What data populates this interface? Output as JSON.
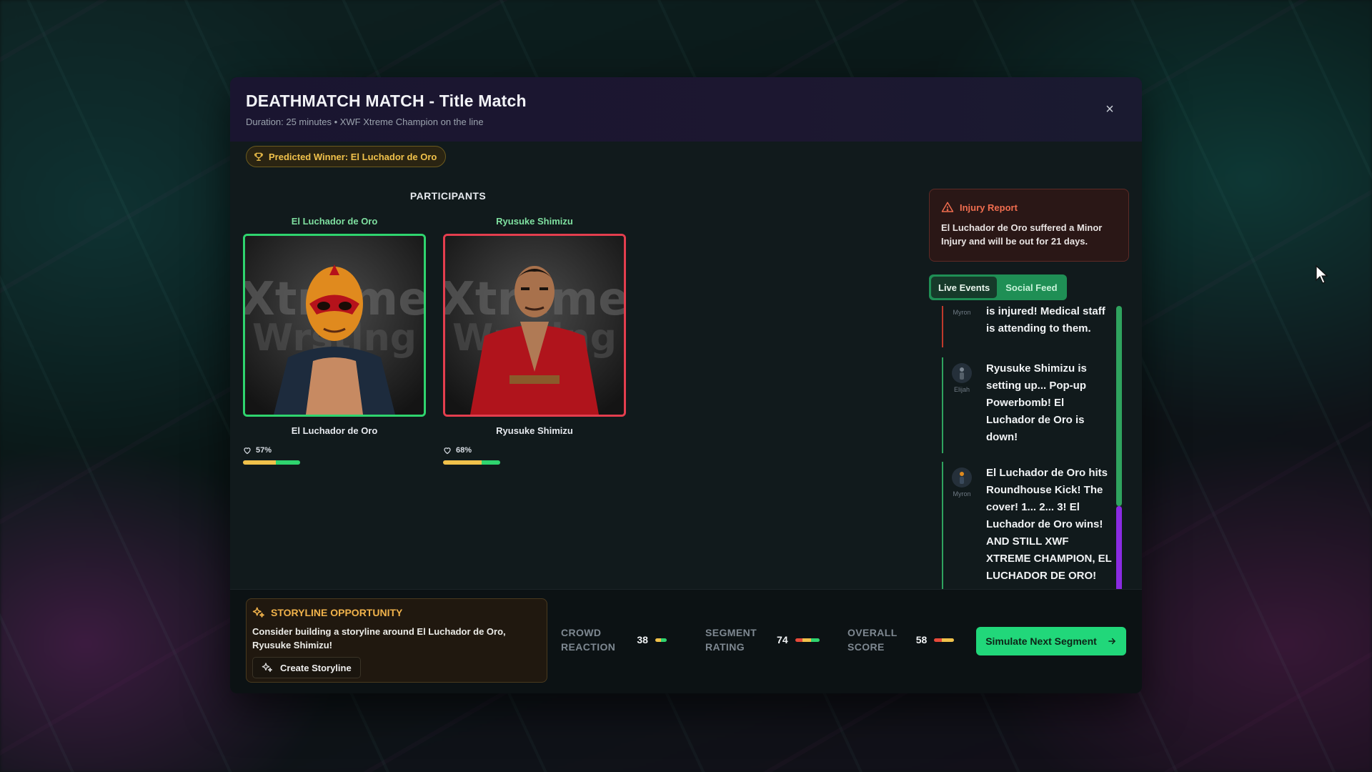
{
  "modal": {
    "title": "DEATHMATCH MATCH - Title Match",
    "subtitle": "Duration: 25 minutes • XWF Xtreme Champion on the line",
    "close_label": "×",
    "predicted_winner": "Predicted Winner: El Luchador de Oro"
  },
  "participants": {
    "title": "PARTICIPANTS",
    "items": [
      {
        "name": "El Luchador de Oro",
        "popularity": "57%",
        "popularity_value": 57,
        "status_color": "#2fd46e"
      },
      {
        "name": "Ryusuke Shimizu",
        "popularity": "68%",
        "popularity_value": 68,
        "status_color": "#e43e4e"
      }
    ]
  },
  "injury": {
    "title": "Injury Report",
    "text": "El Luchador de Oro suffered a Minor Injury and will be out for 21 days."
  },
  "tabs": [
    {
      "label": "Live Events",
      "active": true
    },
    {
      "label": "Social Feed",
      "active": false
    }
  ],
  "feed": [
    {
      "author": "Myron",
      "text": "is injured! Medical staff is attending to them.",
      "tone": "red"
    },
    {
      "author": "Elijah",
      "text": "Ryusuke Shimizu is setting up... Pop-up Powerbomb! El Luchador de Oro is down!",
      "tone": "green"
    },
    {
      "author": "Myron",
      "text": "El Luchador de Oro hits Roundhouse Kick! The cover! 1... 2... 3! El Luchador de Oro wins! AND STILL XWF XTREME CHAMPION, EL LUCHADOR DE ORO!",
      "tone": "green"
    }
  ],
  "storyline": {
    "title": "STORYLINE OPPORTUNITY",
    "text": "Consider building a storyline around El Luchador de Oro, Ryusuke Shimizu!",
    "button": "Create Storyline"
  },
  "metrics": [
    {
      "label_line1": "CROWD",
      "label_line2": "REACTION",
      "value": "38"
    },
    {
      "label_line1": "SEGMENT",
      "label_line2": "RATING",
      "value": "74"
    },
    {
      "label_line1": "OVERALL",
      "label_line2": "SCORE",
      "value": "58"
    }
  ],
  "simulate_button": "Simulate Next Segment",
  "icons": {
    "close": "close-icon",
    "trophy": "trophy-icon",
    "heart": "heart-icon",
    "warning": "warning-icon",
    "sparkles": "sparkles-icon",
    "arrow": "arrow-right-icon"
  },
  "colors": {
    "accent_green": "#21d77a",
    "gold": "#f0c14b",
    "danger": "#e43e4e",
    "purple": "#8a2be2"
  }
}
